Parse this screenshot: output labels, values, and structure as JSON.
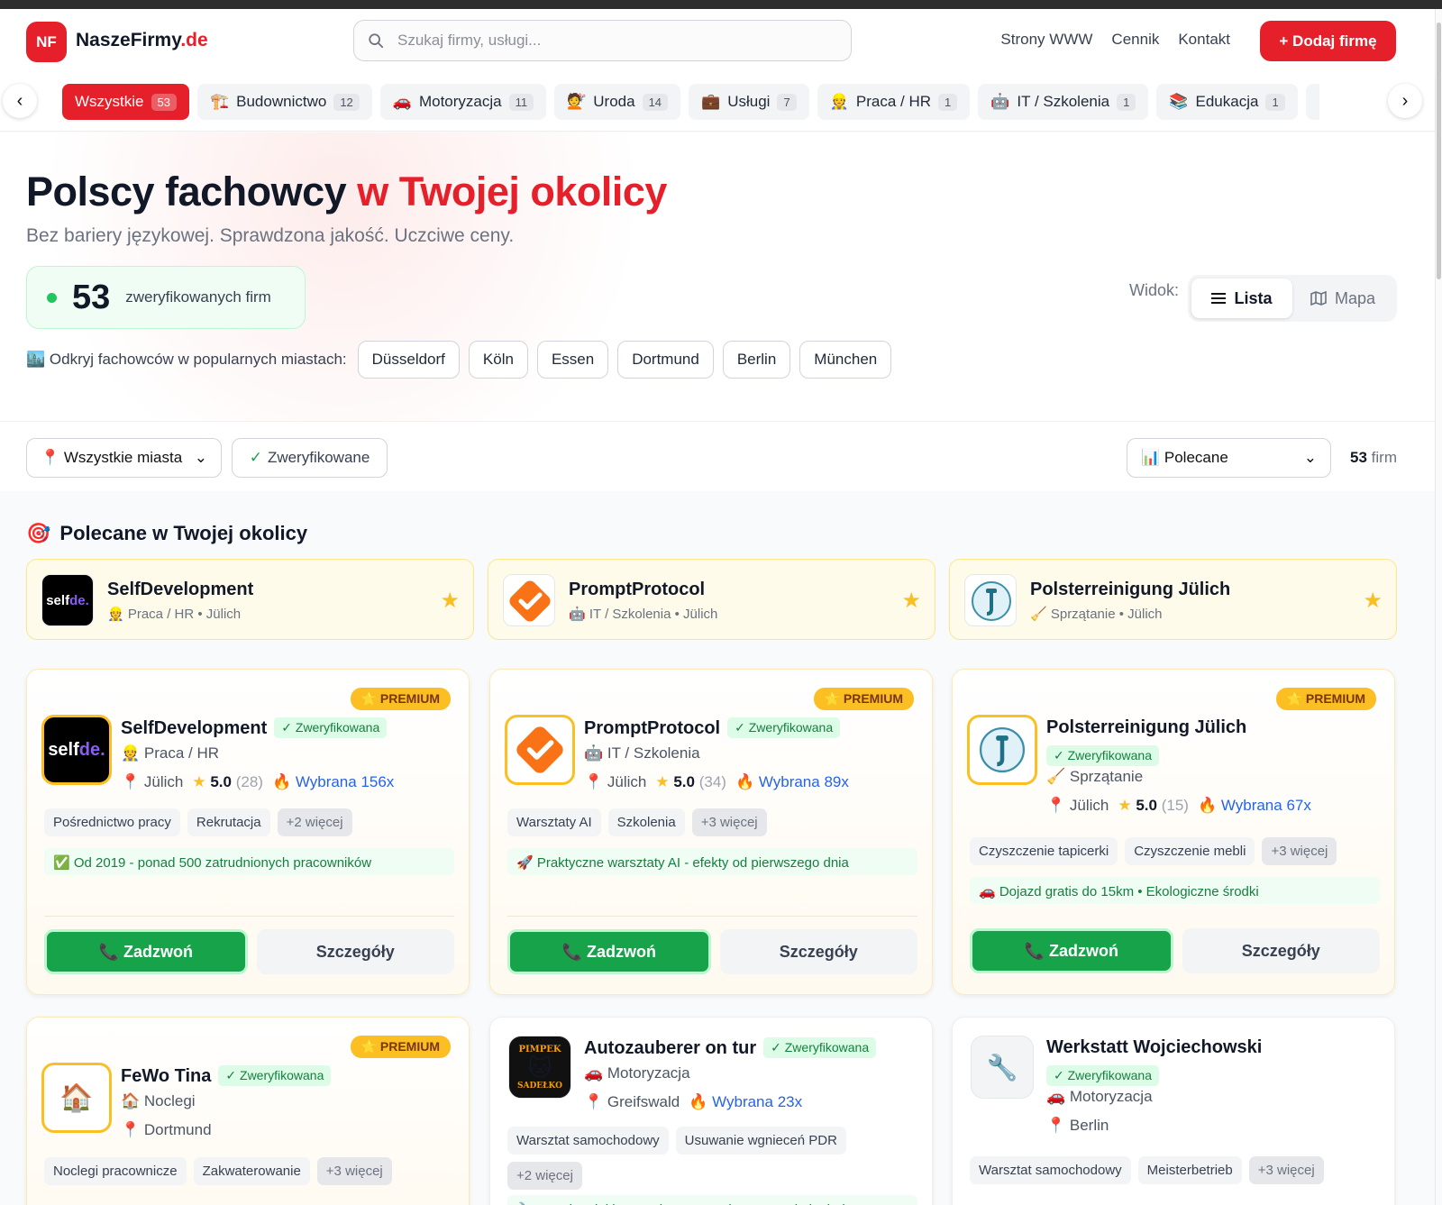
{
  "brand": {
    "logo_initials": "NF",
    "name_main": "NaszeFirmy",
    "name_tld": ".de"
  },
  "search": {
    "placeholder": "Szukaj firmy, usługi..."
  },
  "nav": {
    "links": [
      "Strony WWW",
      "Cennik",
      "Kontakt"
    ],
    "add_button": "+ Dodaj firmę"
  },
  "categories": [
    {
      "label": "Wszystkie",
      "count": "53",
      "icon": "",
      "active": true
    },
    {
      "label": "Budownictwo",
      "count": "12",
      "icon": "🏗️"
    },
    {
      "label": "Motoryzacja",
      "count": "11",
      "icon": "🚗"
    },
    {
      "label": "Uroda",
      "count": "14",
      "icon": "💇"
    },
    {
      "label": "Usługi",
      "count": "7",
      "icon": "💼"
    },
    {
      "label": "Praca / HR",
      "count": "1",
      "icon": "👷"
    },
    {
      "label": "IT / Szkolenia",
      "count": "1",
      "icon": "🤖"
    },
    {
      "label": "Edukacja",
      "count": "1",
      "icon": "📚"
    },
    {
      "label": "",
      "count": "",
      "icon": "🔧"
    }
  ],
  "hero": {
    "title_black": "Polscy fachowcy",
    "title_red": "w Twojej okolicy",
    "subtitle": "Bez bariery językowej. Sprawdzona jakość. Uczciwe ceny.",
    "stat_number": "53",
    "stat_label": "zweryfikowanych firm",
    "view_label": "Widok:",
    "view_list": "Lista",
    "view_map": "Mapa",
    "cities_label": "🏙️ Odkryj fachowców w popularnych miastach:",
    "cities": [
      "Düsseldorf",
      "Köln",
      "Essen",
      "Dortmund",
      "Berlin",
      "München"
    ]
  },
  "filters": {
    "city_select": "📍 Wszystkie miasta",
    "verified": "Zweryfikowane",
    "sort_select": "📊 Polecane",
    "count_number": "53",
    "count_label": "firm"
  },
  "featured": {
    "title": "Polecane w Twojej okolicy",
    "items": [
      {
        "name": "SelfDevelopment",
        "meta": "👷 Praca / HR • Jülich"
      },
      {
        "name": "PromptProtocol",
        "meta": "🤖 IT / Szkolenia • Jülich"
      },
      {
        "name": "Polsterreinigung Jülich",
        "meta": "🧹 Sprzątanie • Jülich"
      }
    ]
  },
  "cards": [
    {
      "name": "SelfDevelopment",
      "verified": "✓ Zweryfikowana",
      "premium": "⭐ PREMIUM",
      "category": "👷 Praca / HR",
      "city": "📍 Jülich",
      "rating": "5.0",
      "reviews": "(28)",
      "popularity": "🔥 Wybrana 156x",
      "tags": [
        "Pośrednictwo pracy",
        "Rekrutacja",
        "+2 więcej"
      ],
      "highlight": "✅ Od 2019 - ponad 500 zatrudnionych pracowników",
      "call": "📞 Zadzwoń",
      "details": "Szczegóły",
      "logo_text": "selfde."
    },
    {
      "name": "PromptProtocol",
      "verified": "✓ Zweryfikowana",
      "premium": "⭐ PREMIUM",
      "category": "🤖 IT / Szkolenia",
      "city": "📍 Jülich",
      "rating": "5.0",
      "reviews": "(34)",
      "popularity": "🔥 Wybrana 89x",
      "tags": [
        "Warsztaty AI",
        "Szkolenia",
        "+3 więcej"
      ],
      "highlight": "🚀 Praktyczne warsztaty AI - efekty od pierwszego dnia",
      "call": "📞 Zadzwoń",
      "details": "Szczegóły"
    },
    {
      "name": "Polsterreinigung Jülich",
      "verified": "✓ Zweryfikowana",
      "premium": "⭐ PREMIUM",
      "category": "🧹 Sprzątanie",
      "city": "📍 Jülich",
      "rating": "5.0",
      "reviews": "(15)",
      "popularity": "🔥 Wybrana 67x",
      "tags": [
        "Czyszczenie tapicerki",
        "Czyszczenie mebli",
        "+3 więcej"
      ],
      "highlight": "🚗 Dojazd gratis do 15km • Ekologiczne środki",
      "call": "📞 Zadzwoń",
      "details": "Szczegóły"
    },
    {
      "name": "FeWo Tina",
      "verified": "✓ Zweryfikowana",
      "premium": "⭐ PREMIUM",
      "category": "🏠 Noclegi",
      "city": "📍 Dortmund",
      "tags": [
        "Noclegi pracownicze",
        "Zakwaterowanie",
        "+3 więcej"
      ],
      "logo_icon": "🏠"
    },
    {
      "name": "Autozauberer on tur",
      "verified": "✓ Zweryfikowana",
      "category": "🚗 Motoryzacja",
      "city": "📍 Greifswald",
      "popularity": "🔥 Wybrana 23x",
      "tags": [
        "Warsztat samochodowy",
        "Usuwanie wgnieceń PDR",
        "+2 więcej"
      ],
      "highlight": "🔧 PDR bez lakierowania - oszczędzasz czas i pieniądze",
      "logo_top": "PIMPEK",
      "logo_bottom": "SADEŁKO"
    },
    {
      "name": "Werkstatt Wojciechowski",
      "verified": "✓ Zweryfikowana",
      "category": "🚗 Motoryzacja",
      "city": "📍 Berlin",
      "tags": [
        "Warsztat samochodowy",
        "Meisterbetrieb",
        "+3 więcej"
      ],
      "logo_icon": "🔧"
    }
  ],
  "colors": {
    "brand_red": "#e5202a",
    "verified_green": "#16a34a",
    "premium_gold": "#fbbf24",
    "link_blue": "#2563eb"
  }
}
